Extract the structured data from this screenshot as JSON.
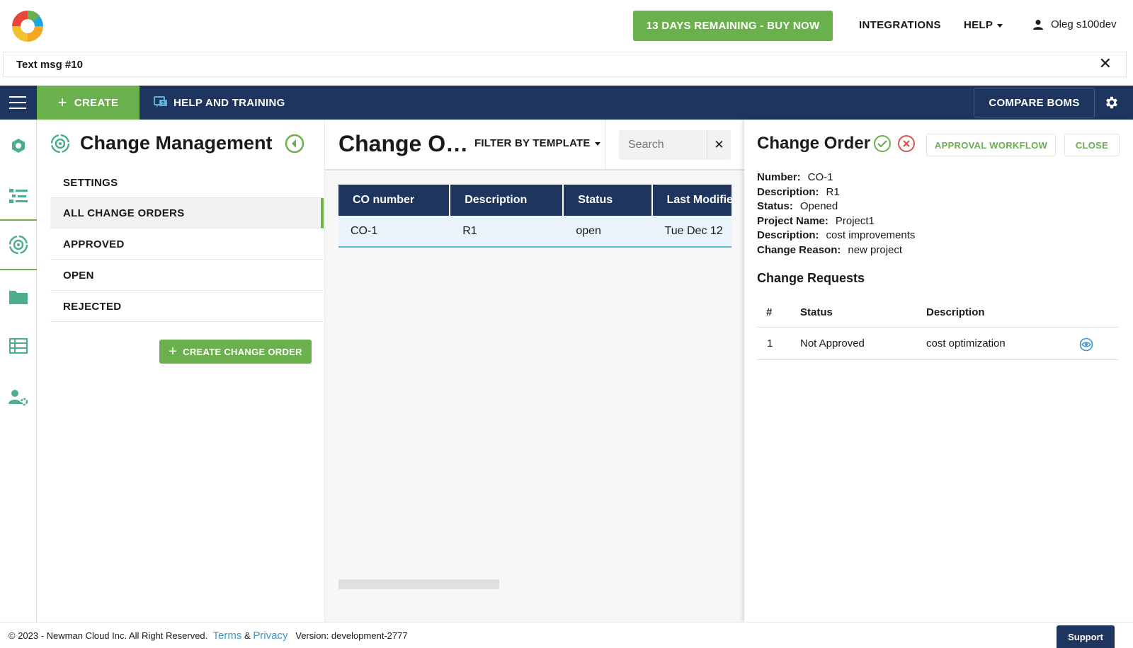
{
  "header": {
    "buy_label": "13 DAYS REMAINING - BUY NOW",
    "integrations_label": "INTEGRATIONS",
    "help_label": "HELP",
    "user_name": "Oleg s100dev"
  },
  "tab": {
    "title": "Text msg #10"
  },
  "navbar": {
    "create_label": "CREATE",
    "help_training_label": "HELP AND TRAINING",
    "compare_label": "COMPARE BOMS"
  },
  "rail": {
    "icons": [
      "hexagon-icon",
      "list-tree-icon",
      "change-management-icon",
      "folder-icon",
      "table-list-icon",
      "user-settings-icon"
    ]
  },
  "left_panel": {
    "title": "Change Management",
    "menu": [
      {
        "label": "SETTINGS"
      },
      {
        "label": "ALL CHANGE ORDERS"
      },
      {
        "label": "APPROVED"
      },
      {
        "label": "OPEN"
      },
      {
        "label": "REJECTED"
      }
    ],
    "create_co_label": "CREATE CHANGE ORDER"
  },
  "middle": {
    "title": "Change Orders",
    "filter_label": "FILTER BY TEMPLATE",
    "search_placeholder": "Search",
    "columns": [
      "CO number",
      "Description",
      "Status",
      "Last Modified"
    ],
    "rows": [
      {
        "co_number": "CO-1",
        "description": "R1",
        "status": "open",
        "last_modified": "Tue Dec 12"
      }
    ]
  },
  "right_panel": {
    "title": "Change Order",
    "approval_label": "APPROVAL WORKFLOW",
    "close_label": "CLOSE",
    "fields": [
      {
        "label": "Number:",
        "value": "CO-1"
      },
      {
        "label": "Description:",
        "value": "R1"
      },
      {
        "label": "Status:",
        "value": "Opened"
      },
      {
        "label": "Project Name:",
        "value": "Project1"
      },
      {
        "label": "Description:",
        "value": "cost improvements"
      },
      {
        "label": "Change Reason:",
        "value": "new project"
      }
    ],
    "requests_title": "Change Requests",
    "requests_columns": [
      "#",
      "Status",
      "Description"
    ],
    "requests": [
      {
        "num": "1",
        "status": "Not Approved",
        "description": "cost optimization"
      }
    ]
  },
  "footer": {
    "copyright": "© 2023 - Newman Cloud Inc. All Right Reserved.",
    "terms": "Terms",
    "amp": "&",
    "privacy": "Privacy",
    "version": "Version: development-2777",
    "support_label": "Support"
  },
  "colors": {
    "brand_green": "#6ab04c",
    "navy": "#1e3560",
    "link_blue": "#3d95c9",
    "reject_red": "#d9534f"
  }
}
